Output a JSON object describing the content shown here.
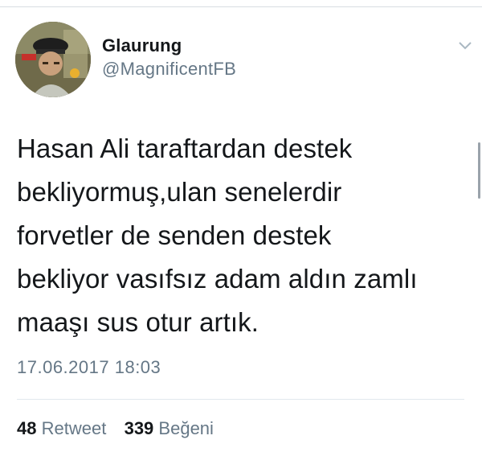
{
  "tweet": {
    "display_name": "Glaurung",
    "handle": "@MagnificentFB",
    "text_lines": [
      "Hasan Ali taraftardan destek",
      "bekliyormuş,ulan senelerdir",
      "forvetler de senden destek",
      "bekliyor vasıfsız adam aldın zamlı",
      "maaşı sus otur artık."
    ],
    "timestamp": "17.06.2017 18:03",
    "retweet_count": "48",
    "retweet_label": "Retweet",
    "like_count": "339",
    "like_label": "Beğeni"
  },
  "icons": {
    "menu": "chevron-down-icon",
    "avatar": "avatar"
  },
  "colors": {
    "primary_text": "#14171a",
    "secondary_text": "#657786",
    "divider": "#e1e8ed"
  }
}
